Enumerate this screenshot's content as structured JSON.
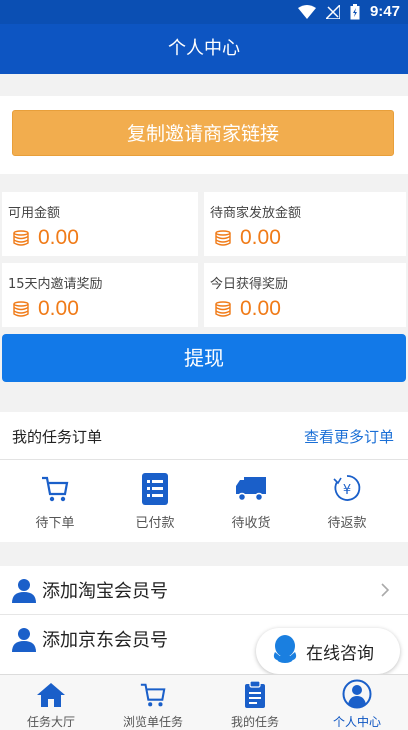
{
  "status_bar": {
    "time": "9:47"
  },
  "app_bar": {
    "title": "个人中心"
  },
  "invite": {
    "label": "复制邀请商家链接"
  },
  "stats": [
    {
      "label": "可用金额",
      "value": "0.00"
    },
    {
      "label": "待商家发放金额",
      "value": "0.00"
    },
    {
      "label": "15天内邀请奖励",
      "value": "0.00"
    },
    {
      "label": "今日获得奖励",
      "value": "0.00"
    }
  ],
  "withdraw": {
    "label": "提现"
  },
  "orders": {
    "title": "我的任务订单",
    "more_label": "查看更多订单",
    "items": [
      {
        "label": "待下单",
        "icon": "cart-icon"
      },
      {
        "label": "已付款",
        "icon": "list-icon"
      },
      {
        "label": "待收货",
        "icon": "truck-icon"
      },
      {
        "label": "待返款",
        "icon": "refund-icon"
      }
    ]
  },
  "accounts": [
    {
      "label": "添加淘宝会员号",
      "icon": "user-icon"
    },
    {
      "label": "添加京东会员号",
      "icon": "user-icon"
    }
  ],
  "consult": {
    "label": "在线咨询",
    "icon": "qq-icon"
  },
  "tabs": [
    {
      "label": "任务大厅",
      "icon": "home-icon"
    },
    {
      "label": "浏览单任务",
      "icon": "cart-icon"
    },
    {
      "label": "我的任务",
      "icon": "clipboard-icon"
    },
    {
      "label": "个人中心",
      "icon": "profile-icon",
      "active": true
    }
  ],
  "colors": {
    "primary": "#0d55c2",
    "accent_orange": "#f2ad4e",
    "amount_orange": "#f07b18",
    "button_blue": "#1279e8",
    "link_blue": "#1a6fd6"
  }
}
